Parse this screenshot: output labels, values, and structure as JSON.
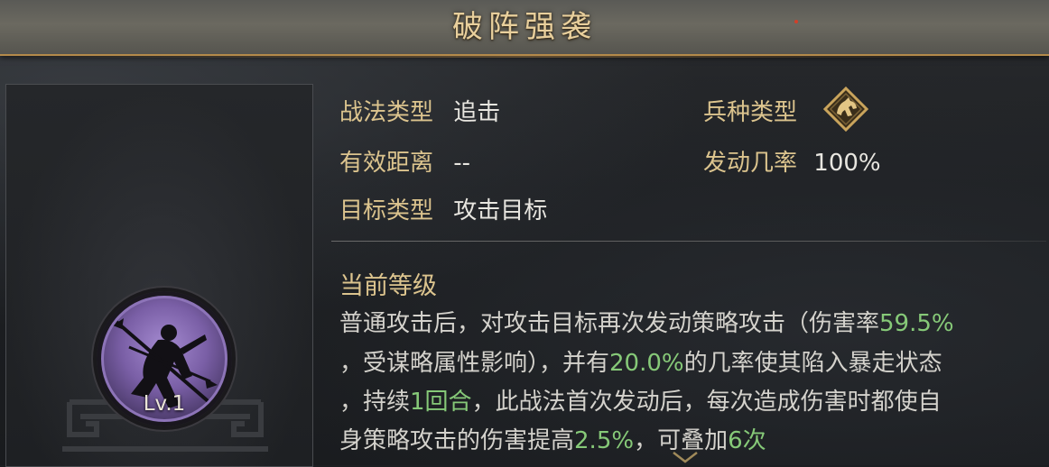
{
  "header": {
    "title": "破阵强袭"
  },
  "portrait": {
    "level": "Lv.1"
  },
  "info": {
    "tactic_type_label": "战法类型",
    "tactic_type_value": "追击",
    "distance_label": "有效距离",
    "distance_value": "--",
    "target_label": "目标类型",
    "target_value": "攻击目标",
    "troop_label": "兵种类型",
    "troop_icon": "cavalry-horse-icon",
    "trigger_label": "发动几率",
    "trigger_value": "100%"
  },
  "current_level": {
    "title": "当前等级",
    "line1": {
      "t1": "普通攻击后，对攻击目标再次发动策略攻击（伤害率",
      "h1": "59.5%"
    },
    "line2": {
      "t1": "，受谋略属性影响），并有",
      "h1": "20.0%",
      "t2": "的几率使其陷入暴走状态"
    },
    "line3": {
      "t1": "，持续",
      "h1": "1回合",
      "t2": "，此战法首次发动后，每次造成伤害时都使自"
    },
    "line4": {
      "t1": "身策略攻击的伤害提高",
      "h1": "2.5%",
      "t2": "，可叠加",
      "h2": "6次"
    }
  },
  "colors": {
    "label": "#dcc48e",
    "highlight": "#86c978",
    "medal": "#8d74b8"
  }
}
